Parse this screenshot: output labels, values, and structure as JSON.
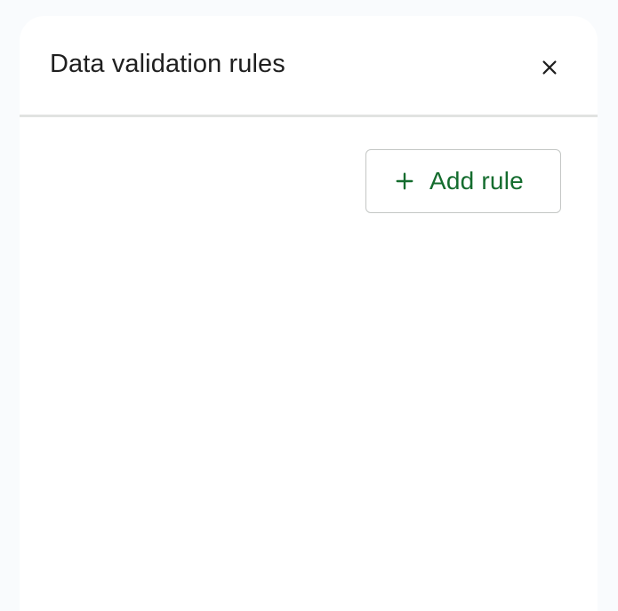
{
  "panel": {
    "title": "Data validation rules",
    "close_icon": "close-icon"
  },
  "actions": {
    "add_rule_label": "Add rule",
    "add_rule_icon": "plus-icon"
  },
  "colors": {
    "accent_green": "#146c2e",
    "title_text": "#1f1f1f",
    "divider": "#e1e3e1",
    "background": "#f9fbfd"
  }
}
